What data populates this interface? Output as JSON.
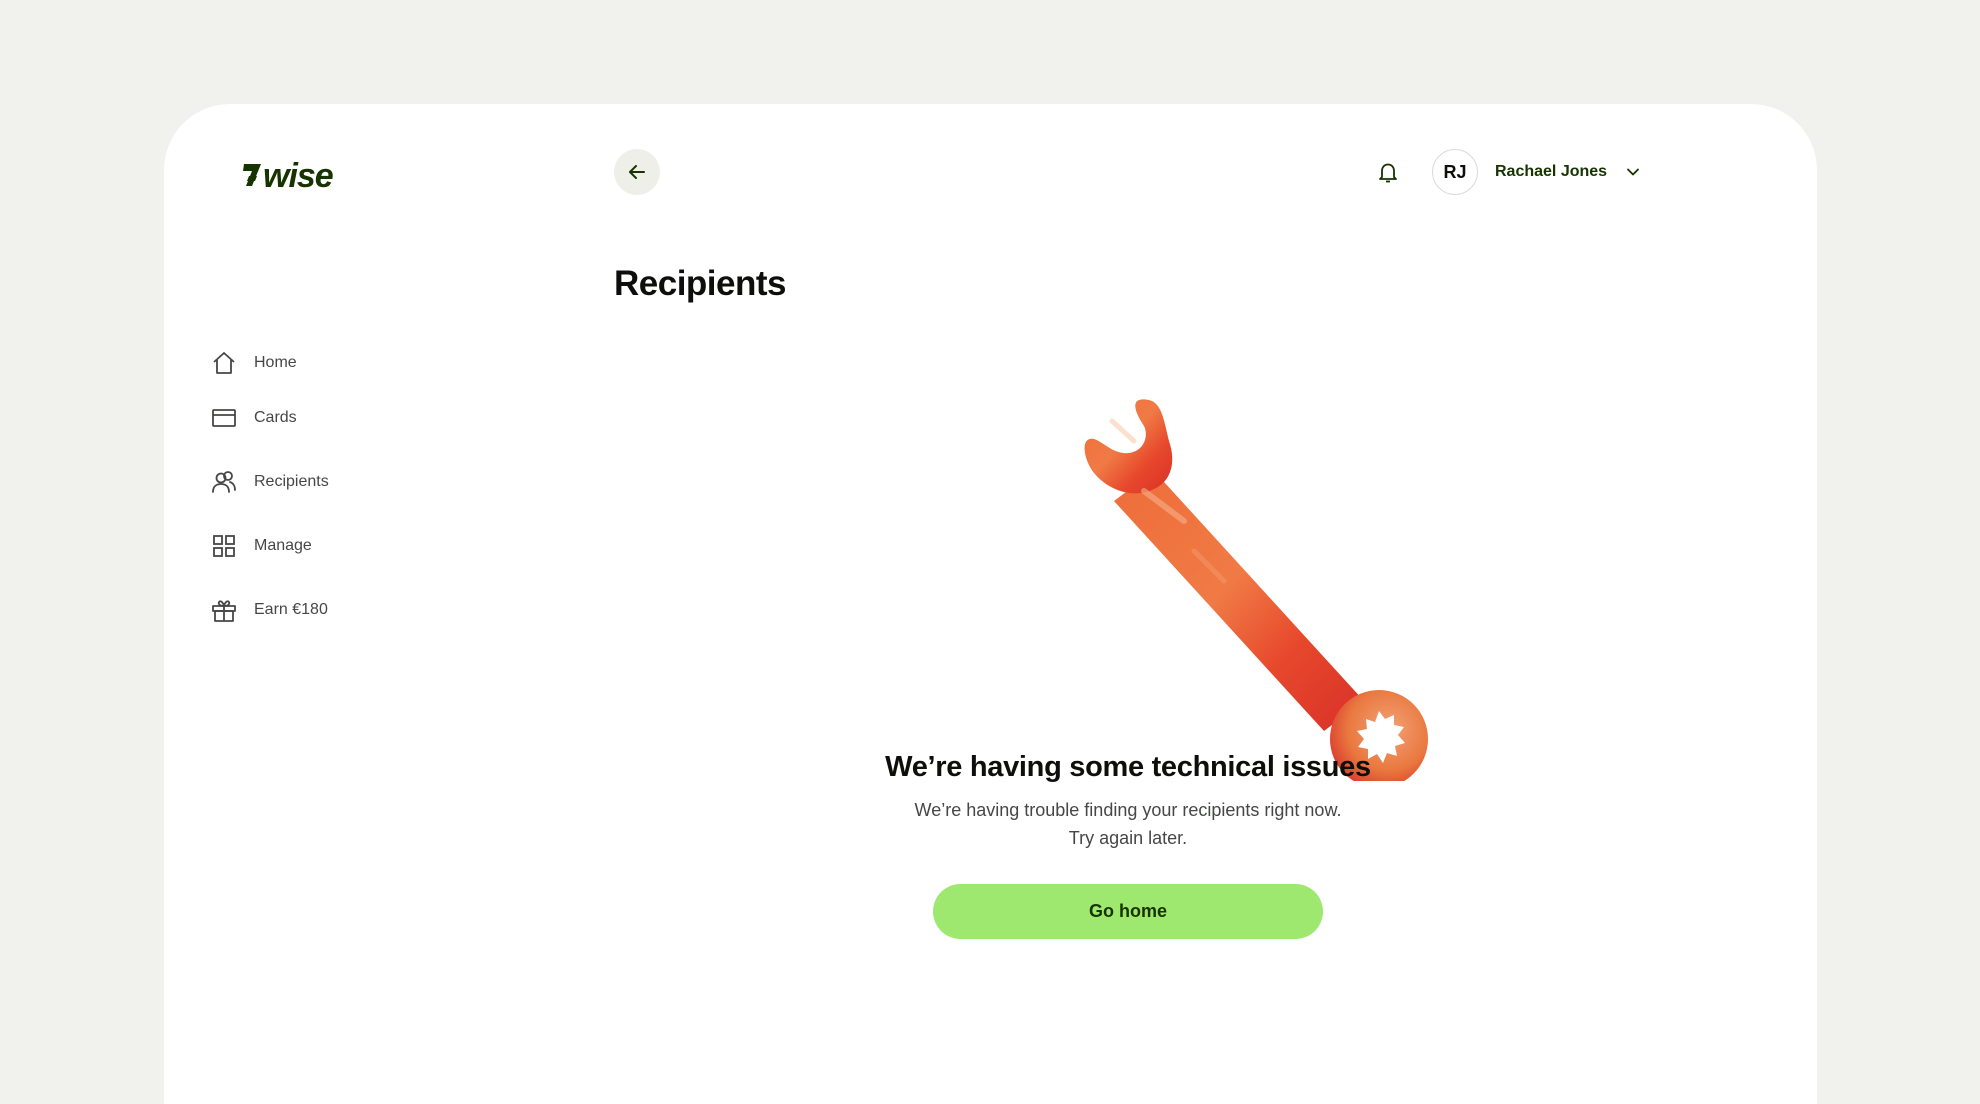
{
  "brand": {
    "name": "wise",
    "logo_color": "#163300",
    "accent": "#9fe870"
  },
  "sidebar": {
    "items": [
      {
        "label": "Home",
        "icon": "home-icon",
        "active": false
      },
      {
        "label": "Cards",
        "icon": "card-icon",
        "active": false
      },
      {
        "label": "Recipients",
        "icon": "recipients-icon",
        "active": true
      },
      {
        "label": "Manage",
        "icon": "grid-icon",
        "active": false
      },
      {
        "label": "Earn €180",
        "icon": "gift-icon",
        "active": false
      }
    ]
  },
  "header": {
    "back_icon": "arrow-left-icon",
    "notification_icon": "bell-icon",
    "user": {
      "initials": "RJ",
      "name": "Rachael Jones",
      "menu_icon": "chevron-down-icon"
    }
  },
  "main": {
    "title": "Recipients",
    "illustration": "wrench-illustration",
    "error": {
      "headline": "We’re having some technical issues",
      "message_line1": "We’re having trouble finding your recipients right now.",
      "message_line2": "Try again later.",
      "button_label": "Go home"
    }
  }
}
